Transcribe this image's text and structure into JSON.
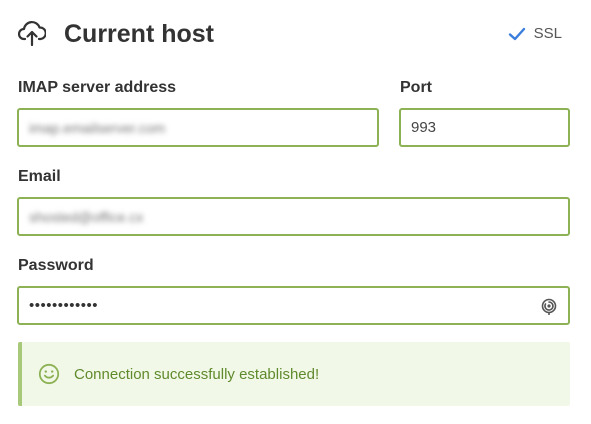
{
  "header": {
    "title": "Current host",
    "icon": "cloud-upload-icon"
  },
  "ssl": {
    "label": "SSL",
    "checked": true,
    "color": "#3b7ddd"
  },
  "form": {
    "imap": {
      "label": "IMAP server address",
      "value": "imap.emailserver.com"
    },
    "port": {
      "label": "Port",
      "value": "993"
    },
    "email": {
      "label": "Email",
      "value": "shosted@office.cx"
    },
    "password": {
      "label": "Password",
      "value": "••••••••••••"
    }
  },
  "status": {
    "message": "Connection successfully established!",
    "icon": "smile-icon",
    "accent": "#8db255"
  }
}
